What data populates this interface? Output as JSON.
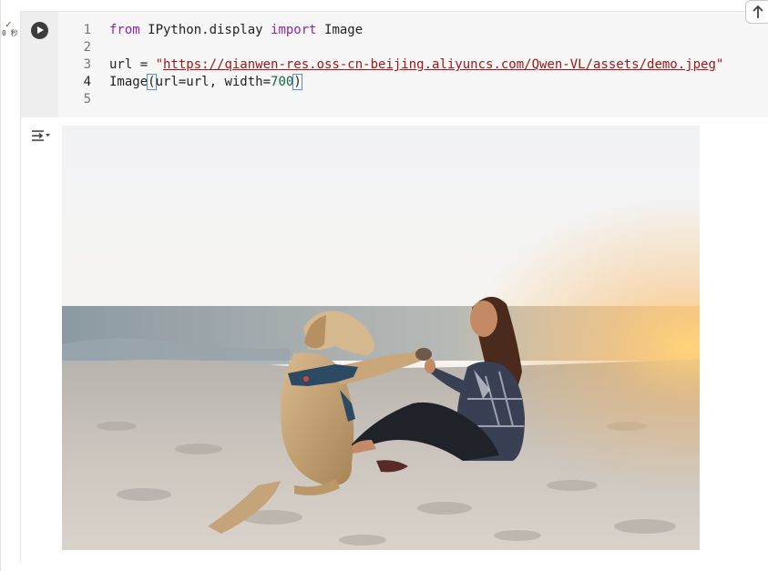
{
  "cell": {
    "status_check": "✓",
    "status_time": "0 秒",
    "run_icon": "play-icon",
    "code_lines": [
      {
        "number": "1",
        "tokens": [
          {
            "t": "from",
            "c": "kw"
          },
          {
            "t": " IPython.display ",
            "c": ""
          },
          {
            "t": "import",
            "c": "kw"
          },
          {
            "t": " Image",
            "c": ""
          }
        ]
      },
      {
        "number": "2",
        "tokens": []
      },
      {
        "number": "3",
        "tokens": [
          {
            "t": "url = ",
            "c": ""
          },
          {
            "t": "\"",
            "c": "str"
          },
          {
            "t": "https://qianwen-res.oss-cn-beijing.aliyuncs.com/Qwen-VL/assets/demo.jpeg",
            "c": "str url"
          },
          {
            "t": "\"",
            "c": "str"
          }
        ]
      },
      {
        "number": "4",
        "tokens": [
          {
            "t": "Image",
            "c": ""
          },
          {
            "t": "(",
            "c": "paren"
          },
          {
            "t": "url=url, width=",
            "c": ""
          },
          {
            "t": "700",
            "c": "num"
          },
          {
            "t": ")",
            "c": "paren"
          }
        ]
      },
      {
        "number": "5",
        "tokens": []
      }
    ],
    "active_line": "4"
  },
  "output": {
    "toggle_icon": "output-collapse-icon",
    "image_subject": "woman and dog high-five on beach",
    "image_width": "700"
  },
  "scroll_top_icon": "arrow-up-icon",
  "colors": {
    "keyword": "#8e24aa",
    "string": "#a31515",
    "number": "#116644",
    "code_background": "#f7f7f7",
    "gutter_background": "#eeeeee",
    "run_button": "#3c3c3c"
  }
}
